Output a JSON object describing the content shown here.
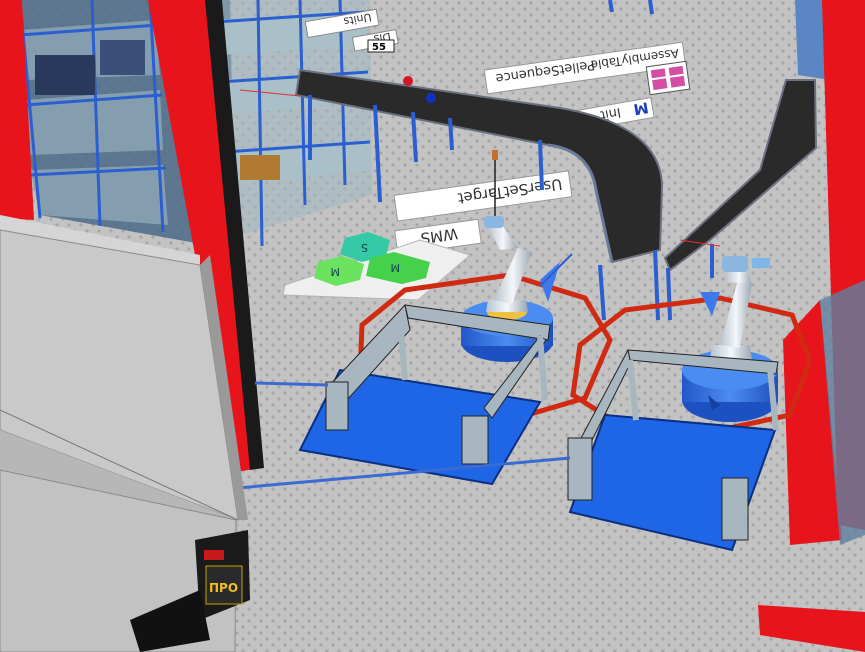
{
  "labels": {
    "units": "Units",
    "dis": "Dis",
    "fifty_five": "55",
    "pellet_sequence": "PelletSequence",
    "assembly_table": "AssemblyTable",
    "init": "Init",
    "user_set_target": "UserSetTarget",
    "wms": "WMS",
    "hex_s": "S",
    "hex_m1": "M",
    "hex_m2": "M",
    "truck_plate": "ПРО"
  },
  "colors": {
    "floor": "#bdbdbd",
    "frame_red": "#e8141c",
    "conveyor": "#2a2a2a",
    "robot_blue": "#2f6fe0",
    "station_blue": "#1e66e6",
    "zone_red": "#d02a12",
    "shelf_glass": "#9fb7c0",
    "shelf_frame": "#2b5fd0"
  },
  "icons": {
    "robot_arm": "robot-arm-icon",
    "storage_rack": "storage-rack-icon",
    "truck": "truck-icon"
  }
}
